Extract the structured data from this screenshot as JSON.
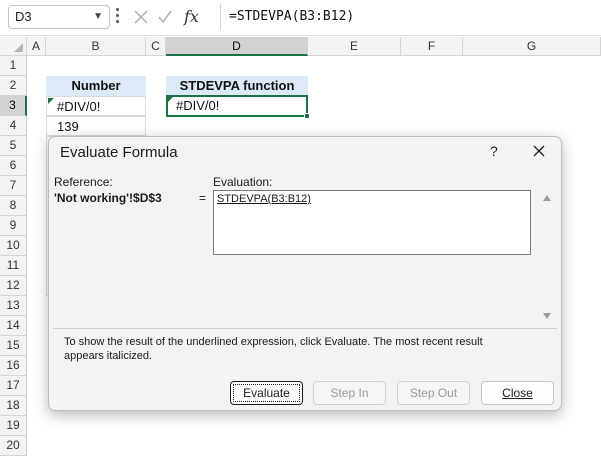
{
  "formula_bar": {
    "name_box": "D3",
    "formula": "=STDEVPA(B3:B12)"
  },
  "columns": [
    "A",
    "B",
    "C",
    "D",
    "E",
    "F",
    "G"
  ],
  "rows": [
    "1",
    "2",
    "3",
    "4",
    "5",
    "6",
    "7",
    "8",
    "9",
    "10",
    "11",
    "12",
    "13",
    "14",
    "15",
    "16",
    "17",
    "18",
    "19",
    "20"
  ],
  "selected_cell": {
    "column": "D",
    "row": "3"
  },
  "cells": {
    "b2": "Number",
    "b3": "#DIV/0!",
    "b4": "139",
    "d2": "STDEVPA function",
    "d3": "#DIV/0!"
  },
  "dialog": {
    "title": "Evaluate Formula",
    "help": "?",
    "reference_label": "Reference:",
    "reference_value": "'Not working'!$D$3",
    "equals": "=",
    "evaluation_label": "Evaluation:",
    "evaluation_expression": "STDEVPA(B3:B12)",
    "info_text": "To show the result of the underlined expression, click Evaluate.  The most recent result appears italicized.",
    "buttons": {
      "evaluate": "Evaluate",
      "step_in": "Step In",
      "step_out": "Step Out",
      "close": "Close"
    }
  },
  "colors": {
    "accent": "#1e7145",
    "header_fill": "#dce9f6"
  }
}
